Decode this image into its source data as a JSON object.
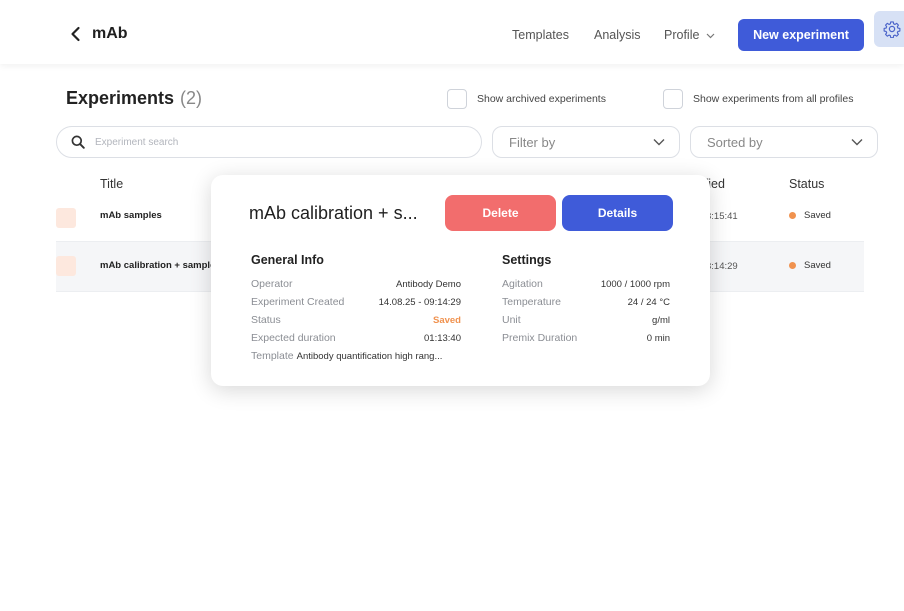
{
  "header": {
    "title": "mAb",
    "nav": {
      "templates": "Templates",
      "analysis": "Analysis",
      "profile": "Profile"
    },
    "new_experiment_label": "New experiment",
    "icons": {
      "back": "chevron-left-icon",
      "profile_menu": "chevron-down-icon",
      "settings": "gear-icon"
    }
  },
  "page": {
    "heading": "Experiments",
    "count": "(2)",
    "show_archived_label": "Show archived experiments",
    "show_all_profiles_label": "Show experiments from all profiles"
  },
  "filters": {
    "search_placeholder": "Experiment search",
    "filter_by": "Filter by",
    "sorted_by": "Sorted by"
  },
  "table": {
    "columns": {
      "title": "Title",
      "modified": "ified",
      "status": "Status"
    },
    "rows": [
      {
        "title": "mAb samples",
        "modified": "3:15:41",
        "status": "Saved"
      },
      {
        "title": "mAb calibration + sample",
        "modified": "3:14:29",
        "status": "Saved"
      }
    ]
  },
  "popup": {
    "title": "mAb calibration + s...",
    "delete_label": "Delete",
    "details_label": "Details",
    "general": {
      "title": "General Info",
      "operator_label": "Operator",
      "operator_value": "Antibody Demo",
      "created_label": "Experiment Created",
      "created_value": "14.08.25 - 09:14:29",
      "status_label": "Status",
      "status_value": "Saved",
      "duration_label": "Expected duration",
      "duration_value": "01:13:40",
      "template_label": "Template",
      "template_value": "Antibody quantification high rang..."
    },
    "settings": {
      "title": "Settings",
      "agitation_label": "Agitation",
      "agitation_value": "1000 / 1000 rpm",
      "temperature_label": "Temperature",
      "temperature_value": "24 / 24 °C",
      "unit_label": "Unit",
      "unit_value": "g/ml",
      "premix_label": "Premix Duration",
      "premix_value": "0 min"
    }
  },
  "colors": {
    "primary": "#3f5bd9",
    "danger": "#f26d6d",
    "saved": "#f0924f",
    "settings_button_bg": "#d7e1f5"
  }
}
